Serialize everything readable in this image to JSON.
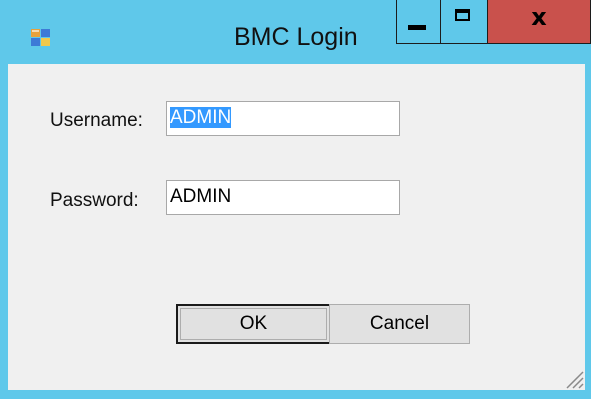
{
  "window": {
    "title": "BMC Login",
    "icon": "app-icon",
    "controls": {
      "minimize_icon": "minimize-icon",
      "maximize_icon": "maximize-icon",
      "close_label": "x"
    },
    "colors": {
      "titlebar": "#5fc8ea",
      "close_button": "#c9514c",
      "client_bg": "#f0f0f0",
      "selection": "#3399ff"
    }
  },
  "form": {
    "username_label": "Username:",
    "username_value": "ADMIN",
    "password_label": "Password:",
    "password_value": "ADMIN",
    "ok_label": "OK",
    "cancel_label": "Cancel"
  }
}
